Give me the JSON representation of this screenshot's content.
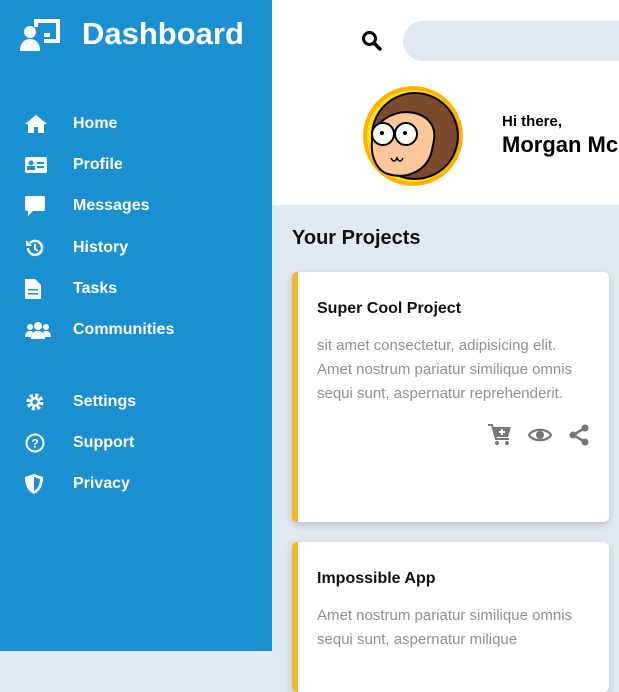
{
  "sidebar": {
    "title": "Dashboard",
    "items": [
      {
        "label": "Home",
        "icon": "home-icon"
      },
      {
        "label": "Profile",
        "icon": "id-card-icon"
      },
      {
        "label": "Messages",
        "icon": "message-icon"
      },
      {
        "label": "History",
        "icon": "history-icon"
      },
      {
        "label": "Tasks",
        "icon": "file-icon"
      },
      {
        "label": "Communities",
        "icon": "users-icon"
      }
    ],
    "items2": [
      {
        "label": "Settings",
        "icon": "gear-icon"
      },
      {
        "label": "Support",
        "icon": "question-icon"
      },
      {
        "label": "Privacy",
        "icon": "shield-icon"
      }
    ]
  },
  "header": {
    "search_placeholder": "",
    "greeting": "Hi there,",
    "user_name": "Morgan Mc"
  },
  "projects": {
    "title": "Your Projects",
    "cards": [
      {
        "title": "Super Cool Project",
        "text": "sit amet consectetur, adipisicing elit. Amet nostrum pariatur similique omnis sequi sunt, aspernatur reprehenderit."
      },
      {
        "title": "Impossible App",
        "text": "Amet nostrum pariatur similique omnis sequi sunt, aspernatur milique"
      }
    ]
  },
  "colors": {
    "sidebar": "#1a8fd2",
    "accent": "#f4b62a",
    "background": "#e2e8f0"
  }
}
